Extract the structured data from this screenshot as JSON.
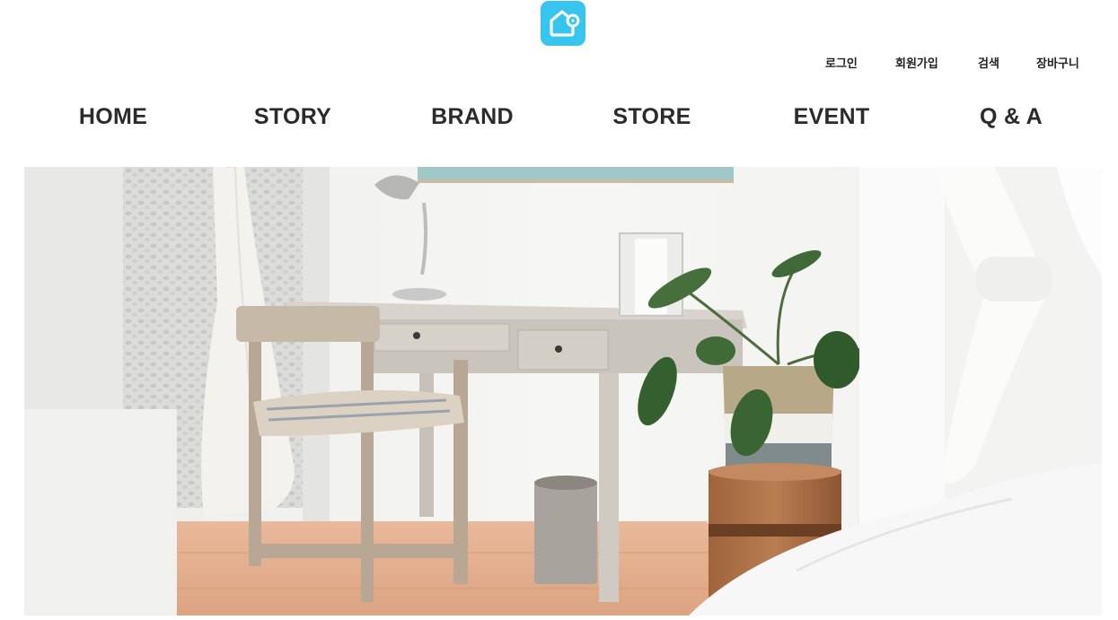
{
  "header": {
    "logo_icon": "home-with-pin-icon",
    "brand_color": "#35c5ef"
  },
  "util_nav": {
    "login": "로그인",
    "join": "회원가입",
    "search": "검색",
    "cart": "장바구니"
  },
  "main_nav": {
    "home": "HOME",
    "story": "STORY",
    "brand": "BRAND",
    "store": "STORE",
    "event": "EVENT",
    "qa": "Q & A"
  },
  "hero": {
    "image": "bright interior photo: wooden desk, chair with cushion, lamp, potted plant on wooden stump"
  }
}
